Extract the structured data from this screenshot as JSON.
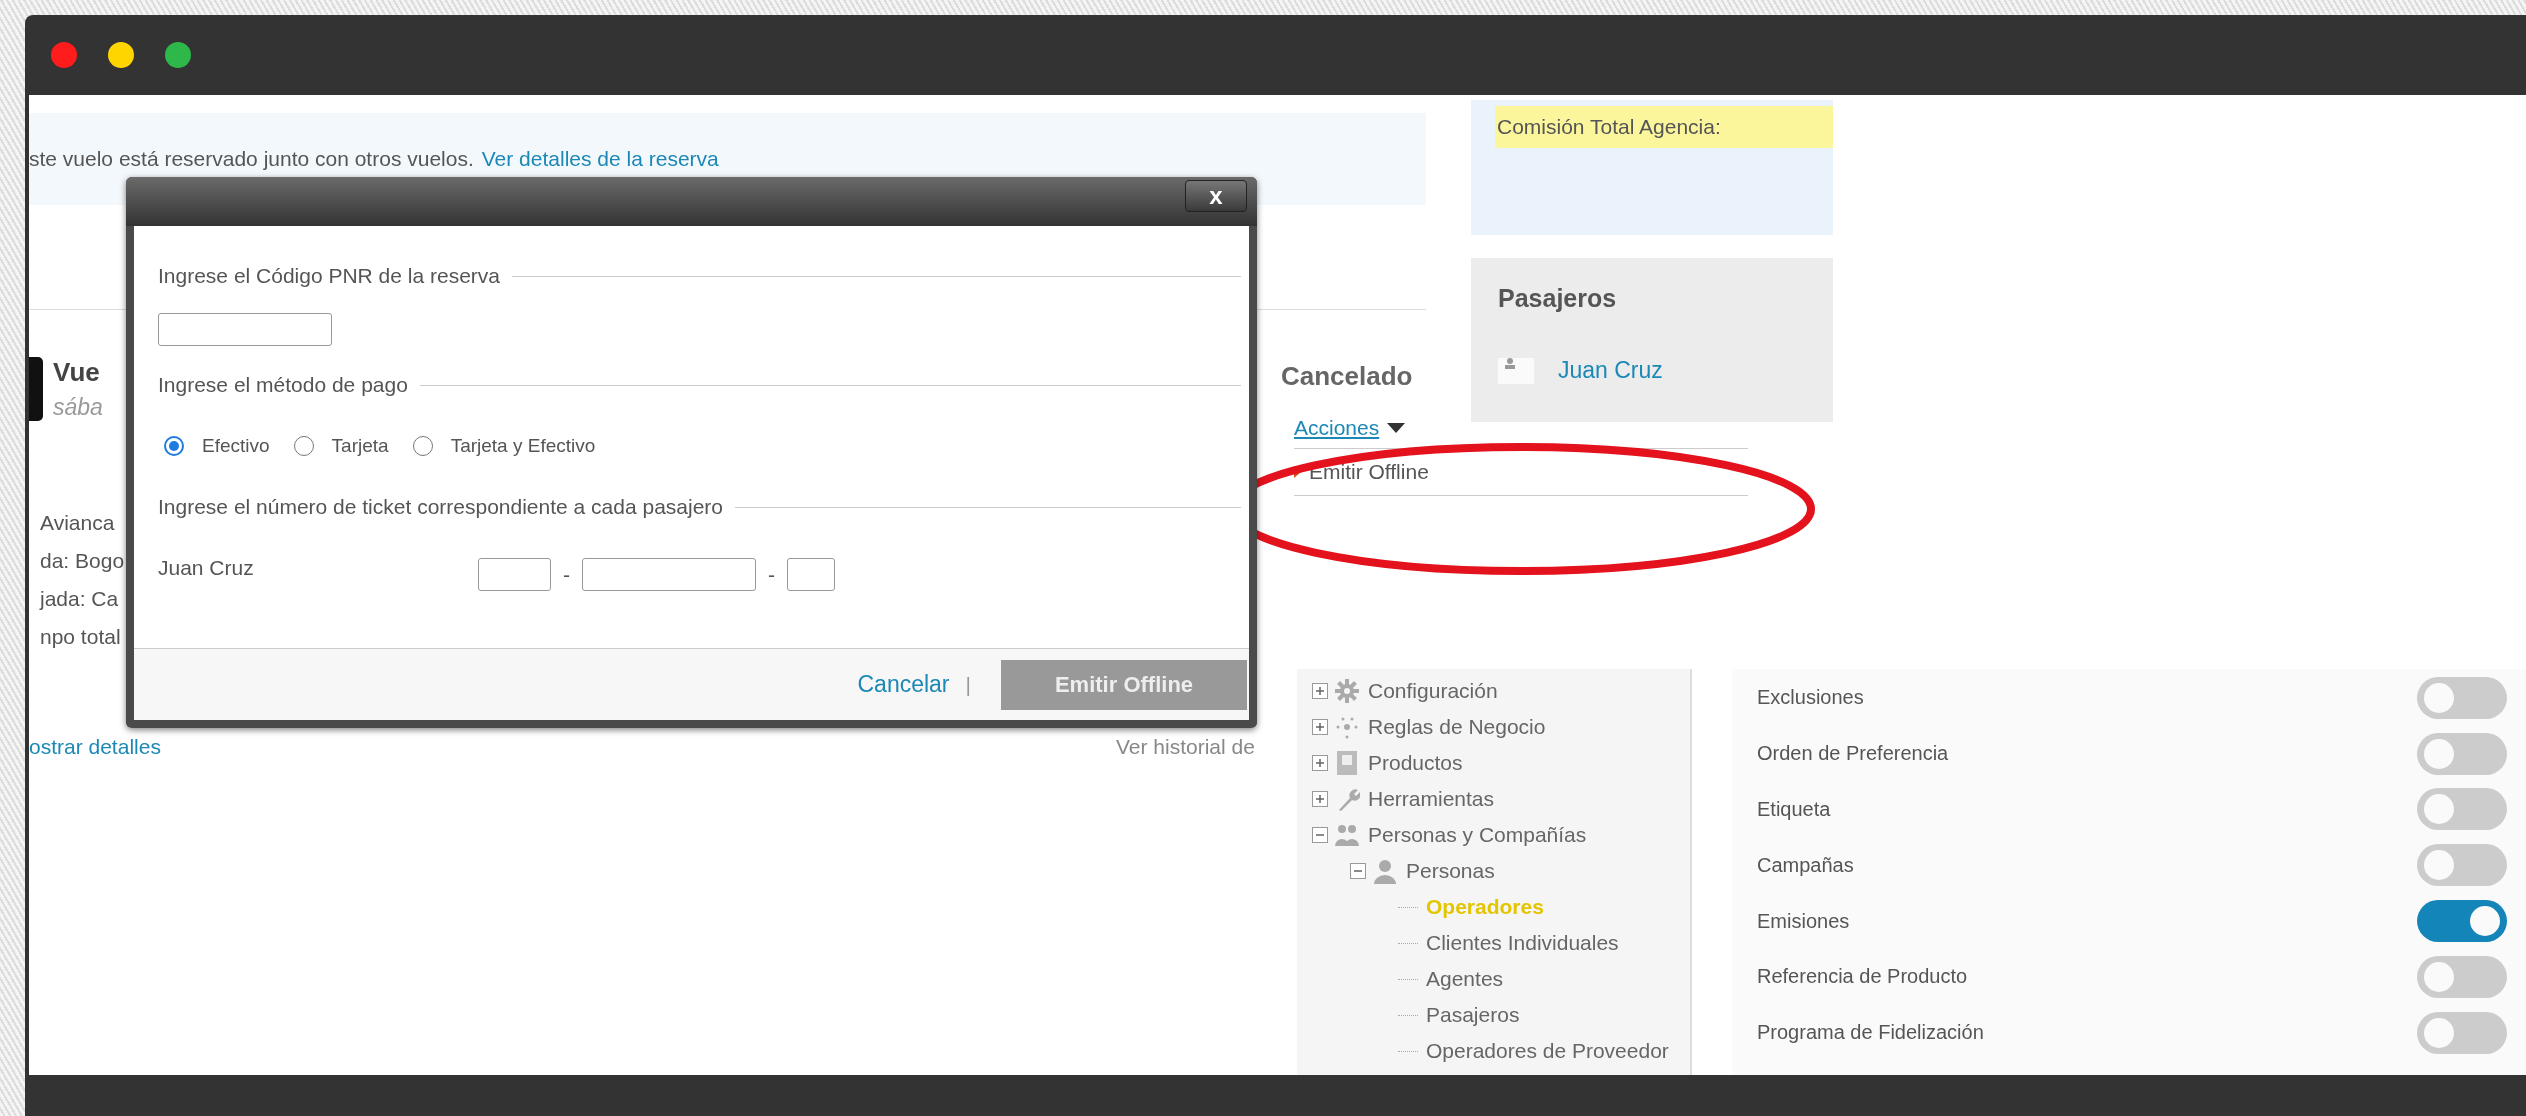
{
  "window": {
    "controls": [
      {
        "color": "#ff1c1c"
      },
      {
        "color": "#ffd500"
      },
      {
        "color": "#2fb84a"
      }
    ]
  },
  "booking": {
    "notice_text": "ste vuelo está reservado junto con otros vuelos.",
    "notice_link": "Ver detalles de la reserva",
    "flight_title": "Vue",
    "flight_date": "sába",
    "flight_lines": [
      "Avianca",
      "da: Bogo",
      "jada: Ca",
      "npo total"
    ],
    "details_link": "ostrar detalles",
    "history_link": "Ver historial de",
    "status": "Cancelado",
    "actions_link": "Acciones",
    "actions_menu": [
      {
        "label": "Emitir Offline"
      }
    ]
  },
  "commission": {
    "label": "Comisión Total Agencia:"
  },
  "passengers": {
    "title": "Pasajeros",
    "items": [
      {
        "name": "Juan Cruz"
      }
    ]
  },
  "dialog": {
    "close_button": "x",
    "pnr_label": "Ingrese el Código PNR de la reserva",
    "payment_label": "Ingrese el método de pago",
    "payment_options": [
      {
        "label": "Efectivo",
        "selected": true
      },
      {
        "label": "Tarjeta",
        "selected": false
      },
      {
        "label": "Tarjeta y Efectivo",
        "selected": false
      }
    ],
    "ticket_label": "Ingrese el número de ticket correspondiente a cada pasajero",
    "tickets": [
      {
        "passenger": "Juan Cruz",
        "separators": [
          "-",
          "-"
        ]
      }
    ],
    "cancel_link": "Cancelar",
    "footer_separator": "|",
    "submit_button": {
      "label": "Emitir Offline",
      "disabled": true
    }
  },
  "tree": {
    "items": [
      {
        "label": "Configuración",
        "kind": "gear",
        "expanded": false,
        "selected": false
      },
      {
        "label": "Reglas de Negocio",
        "kind": "network",
        "expanded": false,
        "selected": false
      },
      {
        "label": "Productos",
        "kind": "box",
        "expanded": false,
        "selected": false
      },
      {
        "label": "Herramientas",
        "kind": "wrench",
        "expanded": false,
        "selected": false
      },
      {
        "label": "Personas y Compañías",
        "kind": "people",
        "expanded": true,
        "selected": false,
        "children": [
          {
            "label": "Personas",
            "kind": "person",
            "expanded": true,
            "selected": false,
            "children": [
              {
                "label": "Operadores",
                "selected": true
              },
              {
                "label": "Clientes Individuales",
                "selected": false
              },
              {
                "label": "Agentes",
                "selected": false
              },
              {
                "label": "Pasajeros",
                "selected": false
              },
              {
                "label": "Operadores de Proveedor",
                "selected": false
              }
            ]
          }
        ]
      }
    ]
  },
  "toggles": {
    "items": [
      {
        "label": "Exclusiones",
        "on": false
      },
      {
        "label": "Orden de Preferencia",
        "on": false
      },
      {
        "label": "Etiqueta",
        "on": false
      },
      {
        "label": "Campañas",
        "on": false
      },
      {
        "label": "Emisiones",
        "on": true
      },
      {
        "label": "Referencia de Producto",
        "on": false
      },
      {
        "label": "Programa de Fidelización",
        "on": false
      }
    ]
  }
}
